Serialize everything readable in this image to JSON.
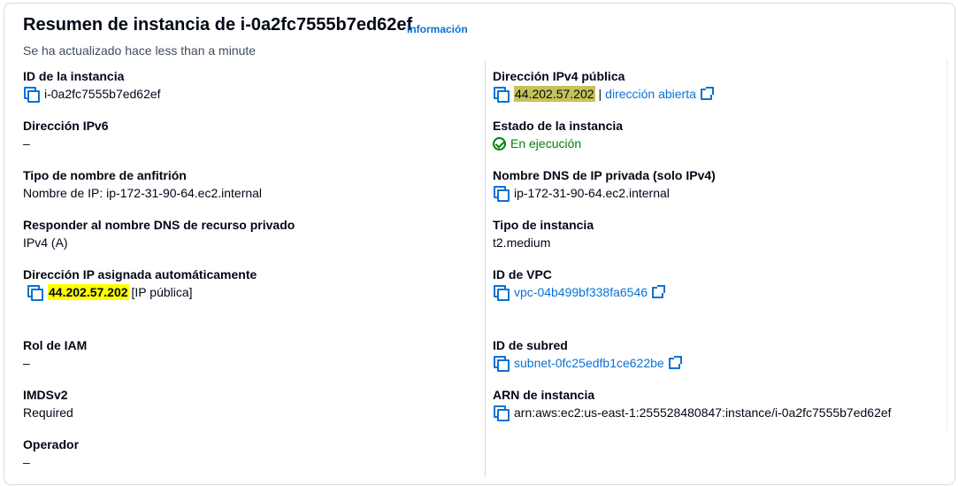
{
  "header": {
    "title": "Resumen de instancia de i-0a2fc7555b7ed62ef",
    "info_link": "Información",
    "updated": "Se ha actualizado hace less than a minute"
  },
  "left": {
    "instance_id": {
      "label": "ID de la instancia",
      "value": "i-0a2fc7555b7ed62ef"
    },
    "ipv6": {
      "label": "Dirección IPv6",
      "value": "–"
    },
    "hostname_type": {
      "label": "Tipo de nombre de anfitrión",
      "value": "Nombre de IP: ip-172-31-90-64.ec2.internal"
    },
    "private_dns_answer": {
      "label": "Responder al nombre DNS de recurso privado",
      "value": "IPv4 (A)"
    },
    "auto_ip": {
      "label": "Dirección IP asignada automáticamente",
      "value": "44.202.57.202",
      "suffix": "[IP pública]"
    },
    "iam_role": {
      "label": "Rol de IAM",
      "value": "–"
    },
    "imdsv2": {
      "label": "IMDSv2",
      "value": "Required"
    },
    "operator": {
      "label": "Operador",
      "value": "–"
    }
  },
  "right": {
    "public_ipv4": {
      "label": "Dirección IPv4 pública",
      "value": "44.202.57.202",
      "separator": "|",
      "open_link": "dirección abierta"
    },
    "instance_state": {
      "label": "Estado de la instancia",
      "value": "En ejecución"
    },
    "private_dns": {
      "label": "Nombre DNS de IP privada (solo IPv4)",
      "value": "ip-172-31-90-64.ec2.internal"
    },
    "instance_type": {
      "label": "Tipo de instancia",
      "value": "t2.medium"
    },
    "vpc_id": {
      "label": "ID de VPC",
      "value": "vpc-04b499bf338fa6546"
    },
    "subnet_id": {
      "label": "ID de subred",
      "value": "subnet-0fc25edfb1ce622be"
    },
    "arn": {
      "label": "ARN de instancia",
      "value": "arn:aws:ec2:us-east-1:255528480847:instance/i-0a2fc7555b7ed62ef"
    }
  },
  "colors": {
    "link": "#0972d3",
    "success": "#037f0c",
    "highlight_yellow": "#ffff00",
    "highlight_olive": "#c6c25a"
  }
}
